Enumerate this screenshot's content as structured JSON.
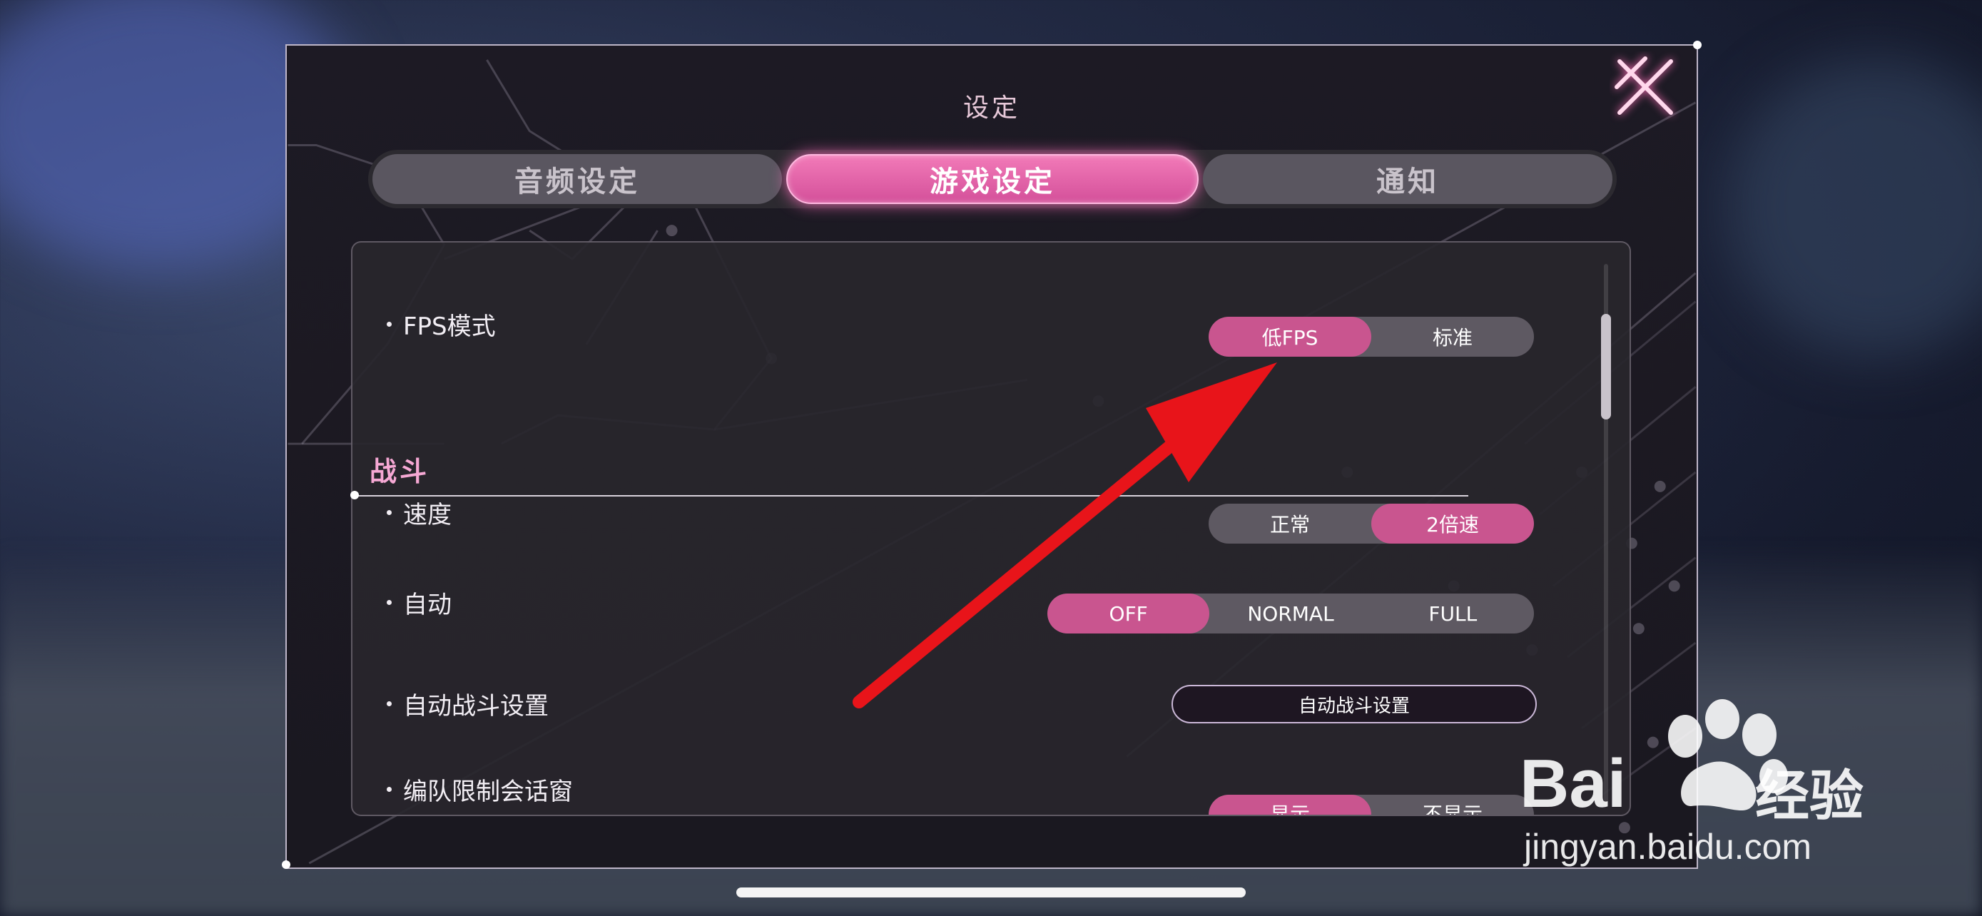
{
  "dialog": {
    "title": "设定",
    "close_icon": "close-x-icon"
  },
  "tabs": [
    {
      "label": "音频设定",
      "active": false
    },
    {
      "label": "游戏设定",
      "active": true
    },
    {
      "label": "通知",
      "active": false
    }
  ],
  "settings": {
    "fps": {
      "label": "FPS模式",
      "options": [
        "低FPS",
        "标准"
      ],
      "selected": "低FPS"
    },
    "battle_section": "战斗",
    "speed": {
      "label": "速度",
      "options": [
        "正常",
        "2倍速"
      ],
      "selected": "2倍速"
    },
    "auto": {
      "label": "自动",
      "options": [
        "OFF",
        "NORMAL",
        "FULL"
      ],
      "selected": "OFF"
    },
    "auto_battle": {
      "label": "自动战斗设置",
      "button": "自动战斗设置"
    },
    "formation_dialog": {
      "label": "编队限制会话窗",
      "options": [
        "显示",
        "不显示"
      ],
      "selected": "显示"
    }
  },
  "watermark": {
    "brand": "Bai",
    "brand_suffix": "经验",
    "url": "jingyan.baidu.com"
  },
  "colors": {
    "accent_pink": "#c9558f",
    "annotation_arrow": "#e8141a"
  }
}
